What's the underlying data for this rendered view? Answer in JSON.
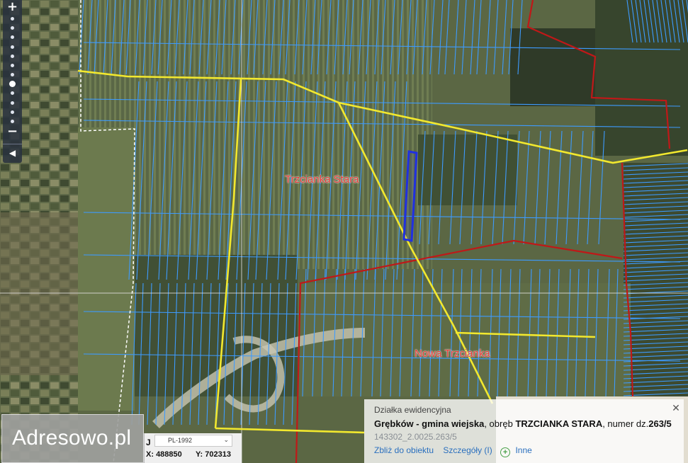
{
  "map": {
    "places": [
      {
        "name": "Trzcianka Stara"
      },
      {
        "name": "Nowa Trzcianka"
      }
    ],
    "colors": {
      "parcel_boundary": "#3d9bff",
      "road": "#f2e82e",
      "precinct_boundary": "#c01818",
      "selected_parcel": "#2030e0",
      "place_label": "#e53a36"
    }
  },
  "zoom": {
    "in_icon": "plus",
    "out_icon": "minus",
    "in_label": "+",
    "out_label": "−",
    "collapse_label": "◀",
    "levels": 12,
    "current_level": 7
  },
  "logo": {
    "text": "Adresowo.pl"
  },
  "coords": {
    "crs": "PL-1992",
    "x_label": "X:",
    "x_value": "488850",
    "y_label": "Y:",
    "y_value": "702313",
    "caret": "J"
  },
  "info": {
    "title": "Działka ewidencyjna",
    "gmina": "Grębków - gmina wiejska",
    "obreb_prefix": ", obręb",
    "obreb": "TRZCIANKA STARA",
    "numer_prefix": ", numer dz.",
    "numer": "263/5",
    "id": "143302_2.0025.263/5",
    "links": {
      "zoom": "Zbliż do obiektu",
      "details": "Szczegóły (I)",
      "other": "Inne"
    },
    "close_label": "✕"
  }
}
